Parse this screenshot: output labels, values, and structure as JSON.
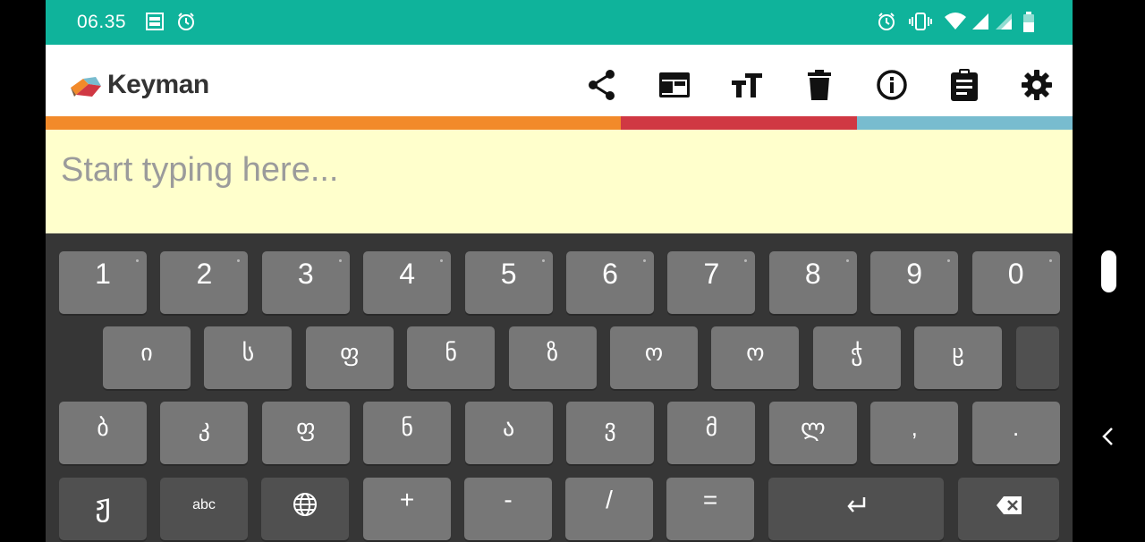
{
  "status_bar": {
    "time": "06.35",
    "left_icons": [
      "jazz-notification-icon",
      "alarm-icon"
    ],
    "right_icons": [
      "alarm-icon",
      "vibrate-icon",
      "wifi-icon",
      "signal-icon",
      "signal-icon",
      "battery-icon"
    ],
    "bg_color": "#0fb39b"
  },
  "app_bar": {
    "title": "Keyman",
    "actions": [
      {
        "name": "share",
        "icon": "share-icon"
      },
      {
        "name": "web-browser",
        "icon": "browser-icon"
      },
      {
        "name": "text-size",
        "icon": "text-size-icon"
      },
      {
        "name": "clear-text",
        "icon": "trash-icon"
      },
      {
        "name": "info",
        "icon": "info-icon"
      },
      {
        "name": "clipboard",
        "icon": "clipboard-icon"
      },
      {
        "name": "settings",
        "icon": "gear-icon"
      }
    ]
  },
  "color_bar": [
    "#f28a2a",
    "#d03843",
    "#78bccf"
  ],
  "editor": {
    "placeholder": "Start typing here..."
  },
  "keyboard": {
    "row1": [
      "1",
      "2",
      "3",
      "4",
      "5",
      "6",
      "7",
      "8",
      "9",
      "0"
    ],
    "row2": [
      "ი",
      "ს",
      "ფ",
      "ნ",
      "ზ",
      "ო",
      "ო",
      "ჭ",
      "ჸ",
      ""
    ],
    "row3": [
      "ბ",
      "კ",
      "ფ",
      "ნ",
      "ა",
      "ვ",
      "მ",
      "ლ",
      ",",
      "."
    ],
    "row4": {
      "keyboard_key": "ჟ",
      "abc": "abc",
      "globe": "globe-icon",
      "plus": "+",
      "minus": "-",
      "slash": "/",
      "equals": "=",
      "enter": "enter-icon",
      "backspace": "backspace-icon"
    }
  },
  "nav": {
    "back": "chevron-left-icon"
  }
}
